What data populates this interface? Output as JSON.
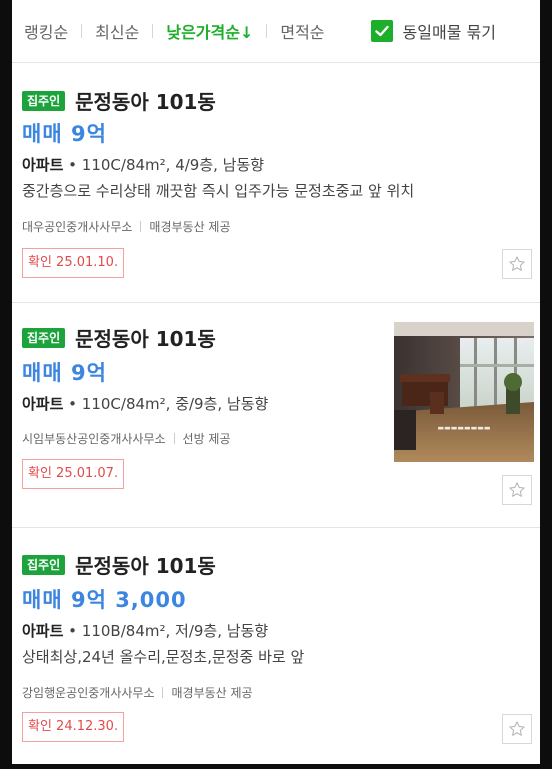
{
  "sort_bar": {
    "options": [
      {
        "label": "랭킹순"
      },
      {
        "label": "최신순"
      },
      {
        "label": "낮은가격순↓"
      },
      {
        "label": "면적순"
      }
    ],
    "active_index": 2,
    "group_checkbox": {
      "label": "동일매물 묶기",
      "checked": true
    }
  },
  "listings": [
    {
      "badge": "집주인",
      "title": "문정동아 101동",
      "price": "매매 9억",
      "type": "아파트",
      "spec": "110C/84m², 4/9층, 남동향",
      "desc": "중간층으로 수리상태 깨끗함 즉시 입주가능 문정초중교 앞 위치",
      "agency": "대우공인중개사사무소",
      "provider": "매경부동산 제공",
      "confirm": "확인 25.01.10.",
      "has_photo": false
    },
    {
      "badge": "집주인",
      "title": "문정동아 101동",
      "price": "매매 9억",
      "type": "아파트",
      "spec": "110C/84m², 중/9층, 남동향",
      "desc": "",
      "agency": "시임부동산공인중개사사무소",
      "provider": "선방 제공",
      "confirm": "확인 25.01.07.",
      "has_photo": true
    },
    {
      "badge": "집주인",
      "title": "문정동아 101동",
      "price": "매매 9억 3,000",
      "type": "아파트",
      "spec": "110B/84m², 저/9층, 남동향",
      "desc": "상태최상,24년 올수리,문정초,문정중 바로 앞",
      "agency": "강임행운공인중개사사무소",
      "provider": "매경부동산 제공",
      "confirm": "확인 24.12.30.",
      "has_photo": false
    }
  ],
  "icons": {
    "check": "check-icon",
    "star": "star-outline-icon"
  },
  "colors": {
    "accent_green": "#1dae2b",
    "price_blue": "#3c86e0",
    "confirm_red": "#e34a4a"
  }
}
